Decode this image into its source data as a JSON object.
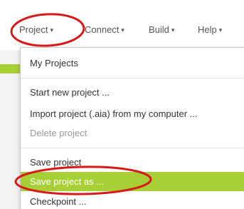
{
  "menubar": {
    "items": [
      {
        "label": "Project"
      },
      {
        "label": "Connect"
      },
      {
        "label": "Build"
      },
      {
        "label": "Help"
      }
    ],
    "caret": "▾"
  },
  "dropdown": {
    "items": [
      {
        "label": "My Projects"
      },
      {
        "label": "Start new project ..."
      },
      {
        "label": "Import project (.aia) from my computer ..."
      },
      {
        "label": "Delete project",
        "state": "disabled"
      },
      {
        "label": "Save project"
      },
      {
        "label": "Save project as ...",
        "state": "highlighted"
      },
      {
        "label": "Checkpoint ..."
      }
    ]
  },
  "colors": {
    "accent": "#a7cf36",
    "annotation_circle": "#d61a1a",
    "menu_text": "#555555",
    "item_text": "#333333",
    "disabled_text": "#999999"
  }
}
